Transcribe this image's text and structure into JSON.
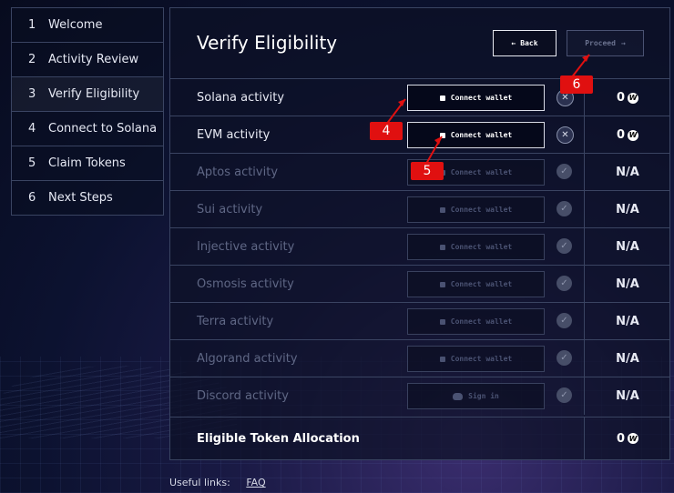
{
  "sidebar": {
    "steps": [
      {
        "num": "1",
        "label": "Welcome"
      },
      {
        "num": "2",
        "label": "Activity Review"
      },
      {
        "num": "3",
        "label": "Verify Eligibility"
      },
      {
        "num": "4",
        "label": "Connect to Solana"
      },
      {
        "num": "5",
        "label": "Claim Tokens"
      },
      {
        "num": "6",
        "label": "Next Steps"
      }
    ]
  },
  "main": {
    "title": "Verify Eligibility",
    "back_label": "Back",
    "proceed_label": "Proceed",
    "rows": [
      {
        "name": "Solana activity",
        "button": "Connect wallet",
        "value": "0"
      },
      {
        "name": "EVM activity",
        "button": "Connect wallet",
        "value": "0"
      },
      {
        "name": "Aptos activity",
        "button": "Connect wallet",
        "value": "N/A"
      },
      {
        "name": "Sui activity",
        "button": "Connect wallet",
        "value": "N/A"
      },
      {
        "name": "Injective activity",
        "button": "Connect wallet",
        "value": "N/A"
      },
      {
        "name": "Osmosis activity",
        "button": "Connect wallet",
        "value": "N/A"
      },
      {
        "name": "Terra activity",
        "button": "Connect wallet",
        "value": "N/A"
      },
      {
        "name": "Algorand activity",
        "button": "Connect wallet",
        "value": "N/A"
      },
      {
        "name": "Discord activity",
        "button": "Sign in",
        "value": "N/A"
      }
    ],
    "total": {
      "label": "Eligible Token Allocation",
      "value": "0"
    },
    "coin_symbol": "W"
  },
  "footer": {
    "label": "Useful links:",
    "link": "FAQ"
  },
  "annotations": {
    "m4": "4",
    "m5": "5",
    "m6": "6"
  },
  "colors": {
    "annotation": "#e01010",
    "border": "#3a4462"
  }
}
